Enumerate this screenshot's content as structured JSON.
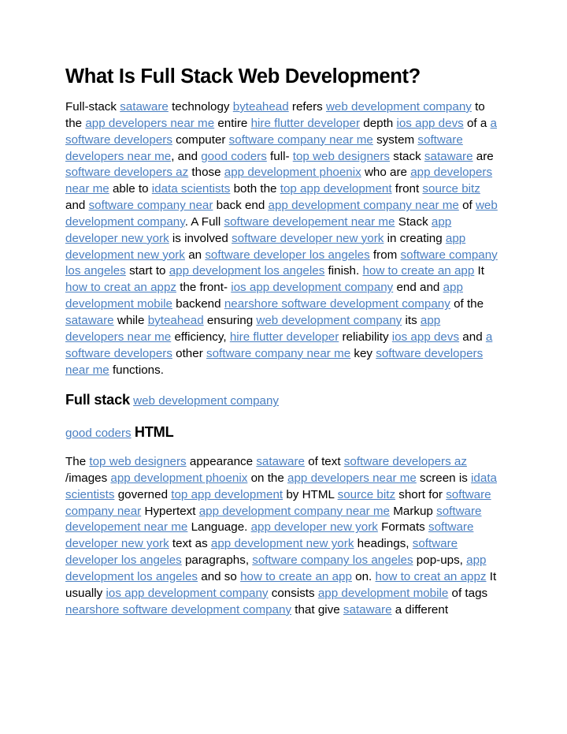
{
  "document": {
    "title": "What Is Full Stack Web Development?",
    "link_color": "#4a7fc1",
    "text_color": "#000000",
    "background_color": "#ffffff",
    "paragraph_1": [
      {
        "type": "text",
        "text": "Full-stack "
      },
      {
        "type": "link",
        "text": "sataware"
      },
      {
        "type": "text",
        "text": " technology "
      },
      {
        "type": "link",
        "text": "byteahead"
      },
      {
        "type": "text",
        "text": " refers "
      },
      {
        "type": "link",
        "text": "web development company"
      },
      {
        "type": "text",
        "text": " to the "
      },
      {
        "type": "link",
        "text": "app developers near me"
      },
      {
        "type": "text",
        "text": " entire "
      },
      {
        "type": "link",
        "text": "hire flutter developer"
      },
      {
        "type": "text",
        "text": " depth "
      },
      {
        "type": "link",
        "text": "ios app devs"
      },
      {
        "type": "text",
        "text": " of a "
      },
      {
        "type": "link",
        "text": "a software developers"
      },
      {
        "type": "text",
        "text": " computer "
      },
      {
        "type": "link",
        "text": "software company near me"
      },
      {
        "type": "text",
        "text": " system "
      },
      {
        "type": "link",
        "text": "software developers near me"
      },
      {
        "type": "text",
        "text": ", and "
      },
      {
        "type": "link",
        "text": "good coders"
      },
      {
        "type": "text",
        "text": " full- "
      },
      {
        "type": "link",
        "text": "top web designers"
      },
      {
        "type": "text",
        "text": " stack "
      },
      {
        "type": "link",
        "text": "sataware"
      },
      {
        "type": "text",
        "text": " are "
      },
      {
        "type": "link",
        "text": "software developers az"
      },
      {
        "type": "text",
        "text": " those "
      },
      {
        "type": "link",
        "text": "app development phoenix"
      },
      {
        "type": "text",
        "text": " who are "
      },
      {
        "type": "link",
        "text": "app developers near me"
      },
      {
        "type": "text",
        "text": " able to "
      },
      {
        "type": "link",
        "text": "idata scientists"
      },
      {
        "type": "text",
        "text": " both the "
      },
      {
        "type": "link",
        "text": "top app development"
      },
      {
        "type": "text",
        "text": " front "
      },
      {
        "type": "link",
        "text": "source bitz"
      },
      {
        "type": "text",
        "text": " and "
      },
      {
        "type": "link",
        "text": "software company near"
      },
      {
        "type": "text",
        "text": " back end "
      },
      {
        "type": "link",
        "text": "app development company near me"
      },
      {
        "type": "text",
        "text": " of "
      },
      {
        "type": "link",
        "text": "web development company"
      },
      {
        "type": "text",
        "text": ". A Full "
      },
      {
        "type": "link",
        "text": "software developement near me"
      },
      {
        "type": "text",
        "text": " Stack "
      },
      {
        "type": "link",
        "text": "app developer new york"
      },
      {
        "type": "text",
        "text": " is involved "
      },
      {
        "type": "link",
        "text": "software developer new york"
      },
      {
        "type": "text",
        "text": " in creating "
      },
      {
        "type": "link",
        "text": "app development new york"
      },
      {
        "type": "text",
        "text": " an "
      },
      {
        "type": "link",
        "text": "software developer los angeles"
      },
      {
        "type": "text",
        "text": " from "
      },
      {
        "type": "link",
        "text": "software company los angeles"
      },
      {
        "type": "text",
        "text": " start to "
      },
      {
        "type": "link",
        "text": "app development los angeles"
      },
      {
        "type": "text",
        "text": " finish. "
      },
      {
        "type": "link",
        "text": "how to create an app"
      },
      {
        "type": "text",
        "text": " It "
      },
      {
        "type": "link",
        "text": "how to creat an appz"
      },
      {
        "type": "text",
        "text": " the front- "
      },
      {
        "type": "link",
        "text": "ios app development company"
      },
      {
        "type": "text",
        "text": " end and "
      },
      {
        "type": "link",
        "text": "app development mobile"
      },
      {
        "type": "text",
        "text": " backend "
      },
      {
        "type": "link",
        "text": "nearshore software development company"
      },
      {
        "type": "text",
        "text": " of the "
      },
      {
        "type": "link",
        "text": "sataware"
      },
      {
        "type": "text",
        "text": " while "
      },
      {
        "type": "link",
        "text": "byteahead"
      },
      {
        "type": "text",
        "text": " ensuring "
      },
      {
        "type": "link",
        "text": "web development company"
      },
      {
        "type": "text",
        "text": " its "
      },
      {
        "type": "link",
        "text": "app developers near me"
      },
      {
        "type": "text",
        "text": " efficiency, "
      },
      {
        "type": "link",
        "text": "hire flutter developer"
      },
      {
        "type": "text",
        "text": " reliability "
      },
      {
        "type": "link",
        "text": "ios app devs"
      },
      {
        "type": "text",
        "text": " and "
      },
      {
        "type": "link",
        "text": "a software developers"
      },
      {
        "type": "text",
        "text": " other "
      },
      {
        "type": "link",
        "text": "software company near me"
      },
      {
        "type": "text",
        "text": " key "
      },
      {
        "type": "link",
        "text": "software developers near me"
      },
      {
        "type": "text",
        "text": " functions."
      }
    ],
    "heading_2": [
      {
        "type": "strong",
        "text": "Full stack"
      },
      {
        "type": "text",
        "text": " "
      },
      {
        "type": "link",
        "text": "web development company"
      }
    ],
    "heading_3": [
      {
        "type": "link",
        "text": "good coders"
      },
      {
        "type": "text",
        "text": " "
      },
      {
        "type": "strong",
        "text": "HTML"
      }
    ],
    "paragraph_2": [
      {
        "type": "text",
        "text": "The "
      },
      {
        "type": "link",
        "text": "top web designers"
      },
      {
        "type": "text",
        "text": " appearance "
      },
      {
        "type": "link",
        "text": "sataware"
      },
      {
        "type": "text",
        "text": " of text "
      },
      {
        "type": "link",
        "text": "software developers az"
      },
      {
        "type": "text",
        "text": " /images "
      },
      {
        "type": "link",
        "text": "app development phoenix"
      },
      {
        "type": "text",
        "text": " on the "
      },
      {
        "type": "link",
        "text": "app developers near me"
      },
      {
        "type": "text",
        "text": " screen is "
      },
      {
        "type": "link",
        "text": "idata scientists"
      },
      {
        "type": "text",
        "text": " governed "
      },
      {
        "type": "link",
        "text": "top app development"
      },
      {
        "type": "text",
        "text": " by HTML "
      },
      {
        "type": "link",
        "text": "source bitz"
      },
      {
        "type": "text",
        "text": " short for "
      },
      {
        "type": "link",
        "text": "software company near"
      },
      {
        "type": "text",
        "text": " Hypertext "
      },
      {
        "type": "link",
        "text": "app development company near me"
      },
      {
        "type": "text",
        "text": " Markup "
      },
      {
        "type": "link",
        "text": "software developement near me"
      },
      {
        "type": "text",
        "text": " Language. "
      },
      {
        "type": "link",
        "text": "app developer new york"
      },
      {
        "type": "text",
        "text": " Formats "
      },
      {
        "type": "link",
        "text": "software developer new york"
      },
      {
        "type": "text",
        "text": " text as "
      },
      {
        "type": "link",
        "text": "app development new york"
      },
      {
        "type": "text",
        "text": " headings, "
      },
      {
        "type": "link",
        "text": "software developer los angeles"
      },
      {
        "type": "text",
        "text": " paragraphs, "
      },
      {
        "type": "link",
        "text": "software company los angeles"
      },
      {
        "type": "text",
        "text": " pop-ups, "
      },
      {
        "type": "link",
        "text": "app development los angeles"
      },
      {
        "type": "text",
        "text": " and so "
      },
      {
        "type": "link",
        "text": "how to create an app"
      },
      {
        "type": "text",
        "text": " on. "
      },
      {
        "type": "link",
        "text": "how to creat an appz"
      },
      {
        "type": "text",
        "text": " It usually "
      },
      {
        "type": "link",
        "text": "ios app development company"
      },
      {
        "type": "text",
        "text": " consists "
      },
      {
        "type": "link",
        "text": "app development mobile"
      },
      {
        "type": "text",
        "text": " of tags "
      },
      {
        "type": "link",
        "text": "nearshore software development company"
      },
      {
        "type": "text",
        "text": " that give "
      },
      {
        "type": "link",
        "text": "sataware"
      },
      {
        "type": "text",
        "text": " a different"
      }
    ]
  }
}
